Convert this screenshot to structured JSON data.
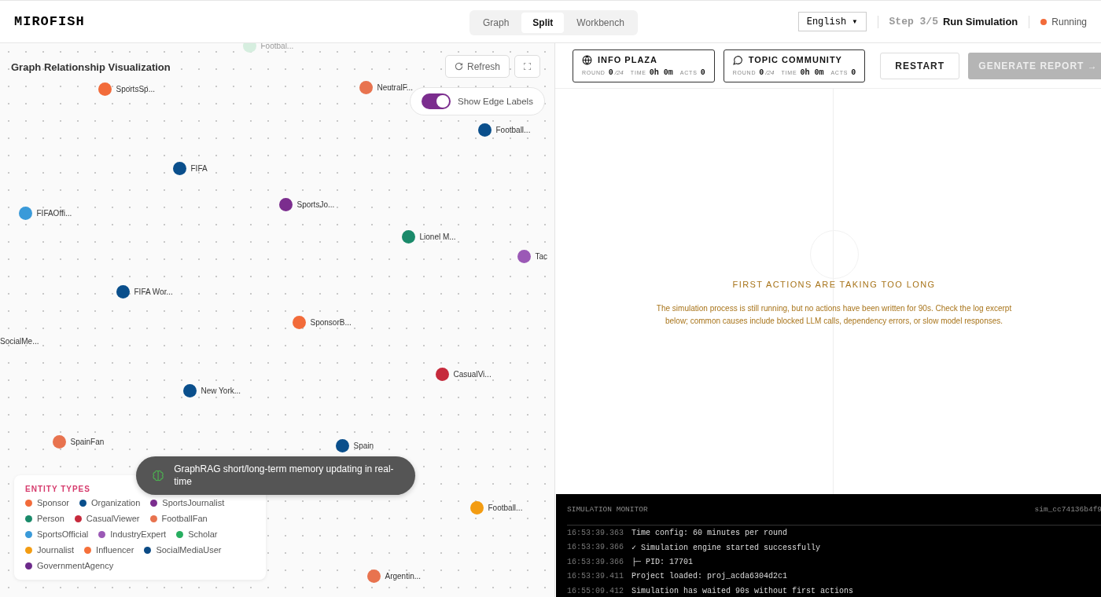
{
  "header": {
    "logo": "MIROFISH",
    "view_modes": [
      {
        "label": "Graph",
        "selected": false
      },
      {
        "label": "Split",
        "selected": true
      },
      {
        "label": "Workbench",
        "selected": false
      }
    ],
    "language": "English ▾",
    "step": {
      "counter": "Step 3/5",
      "name": "Run Simulation"
    },
    "status": {
      "label": "Running",
      "color": "#f26b3a"
    }
  },
  "graph": {
    "title": "Graph Relationship Visualization",
    "refresh": "Refresh",
    "edge_labels": {
      "label": "Show Edge Labels",
      "on": true
    },
    "nodes": [
      {
        "label": "Footbal...",
        "color": "#d6eedf",
        "faded": true
      },
      {
        "label": "SportsSp...",
        "color": "#f26b3a",
        "faded": false
      },
      {
        "label": "NeutralF...",
        "color": "#e8734f",
        "faded": false
      },
      {
        "label": "Football...",
        "color": "#0a4f8c",
        "faded": false
      },
      {
        "label": "FIFA",
        "color": "#0a4f8c",
        "faded": false
      },
      {
        "label": "SportsJo...",
        "color": "#7b2d8e",
        "faded": false
      },
      {
        "label": "FIFAOffi...",
        "color": "#3a9ad9",
        "faded": false
      },
      {
        "label": "Lionel M...",
        "color": "#1a8a6a",
        "faded": false
      },
      {
        "label": "Tac",
        "color": "#9b59b6",
        "faded": false
      },
      {
        "label": "FIFA Wor...",
        "color": "#0a4f8c",
        "faded": false
      },
      {
        "label": "SponsorB...",
        "color": "#f26b3a",
        "faded": false
      },
      {
        "label": "SocialMe...",
        "faded": false
      },
      {
        "label": "CasualVi...",
        "color": "#c62a3c",
        "faded": false
      },
      {
        "label": "New York...",
        "color": "#0a4f8c",
        "faded": false
      },
      {
        "label": "SpainFan",
        "color": "#e8734f",
        "faded": false
      },
      {
        "label": "Spain",
        "color": "#0a4f8c",
        "faded": false
      },
      {
        "label": "Football...",
        "color": "#f39c12",
        "faded": false
      },
      {
        "label": "Argentin...",
        "color": "#e8734f",
        "faded": false
      }
    ],
    "legend": {
      "title": "ENTITY TYPES",
      "items": [
        {
          "label": "Sponsor",
          "color": "#f26b3a"
        },
        {
          "label": "Organization",
          "color": "#0a4f8c"
        },
        {
          "label": "SportsJournalist",
          "color": "#7b2d8e"
        },
        {
          "label": "Person",
          "color": "#1a8a6a"
        },
        {
          "label": "CasualViewer",
          "color": "#c62a3c"
        },
        {
          "label": "FootballFan",
          "color": "#e8734f"
        },
        {
          "label": "SportsOfficial",
          "color": "#3a9ad9"
        },
        {
          "label": "IndustryExpert",
          "color": "#9b59b6"
        },
        {
          "label": "Scholar",
          "color": "#27ae60"
        },
        {
          "label": "Journalist",
          "color": "#f39c12"
        },
        {
          "label": "Influencer",
          "color": "#f5703a"
        },
        {
          "label": "SocialMediaUser",
          "color": "#0b4a85"
        },
        {
          "label": "GovernmentAgency",
          "color": "#6c2a8a"
        }
      ]
    },
    "toast": "GraphRAG short/long-term memory updating in real-time"
  },
  "simulation": {
    "platforms": [
      {
        "kind": "plaza",
        "name": "INFO PLAZA",
        "stats": [
          {
            "label": "ROUND",
            "value": "0",
            "suffix": "/24"
          },
          {
            "label": "TIME",
            "value": "0h 0m"
          },
          {
            "label": "ACTS",
            "value": "0"
          }
        ]
      },
      {
        "kind": "community",
        "name": "TOPIC COMMUNITY",
        "stats": [
          {
            "label": "ROUND",
            "value": "0",
            "suffix": "/24"
          },
          {
            "label": "TIME",
            "value": "0h 0m"
          },
          {
            "label": "ACTS",
            "value": "0"
          }
        ]
      }
    ],
    "restart": "RESTART",
    "generate": {
      "label": "GENERATE REPORT →",
      "disabled": true
    },
    "notice": {
      "title": "FIRST ACTIONS ARE TAKING TOO LONG",
      "body": "The simulation process is still running, but no actions have been written for 90s. Check the log excerpt below; common causes include blocked LLM calls, dependency errors, or slow model responses."
    },
    "monitor": {
      "title": "SIMULATION MONITOR",
      "id": "sim_cc74136b4f9",
      "logs": [
        {
          "time": "16:53:39.363",
          "message": "Time config: 60 minutes per round"
        },
        {
          "time": "16:53:39.366",
          "message": "✓ Simulation engine started successfully"
        },
        {
          "time": "16:53:39.366",
          "message": "├─ PID: 17701"
        },
        {
          "time": "16:53:39.411",
          "message": "Project loaded: proj_acda6304d2c1"
        },
        {
          "time": "16:55:09.412",
          "message": "Simulation has waited 90s without first actions"
        }
      ]
    }
  }
}
